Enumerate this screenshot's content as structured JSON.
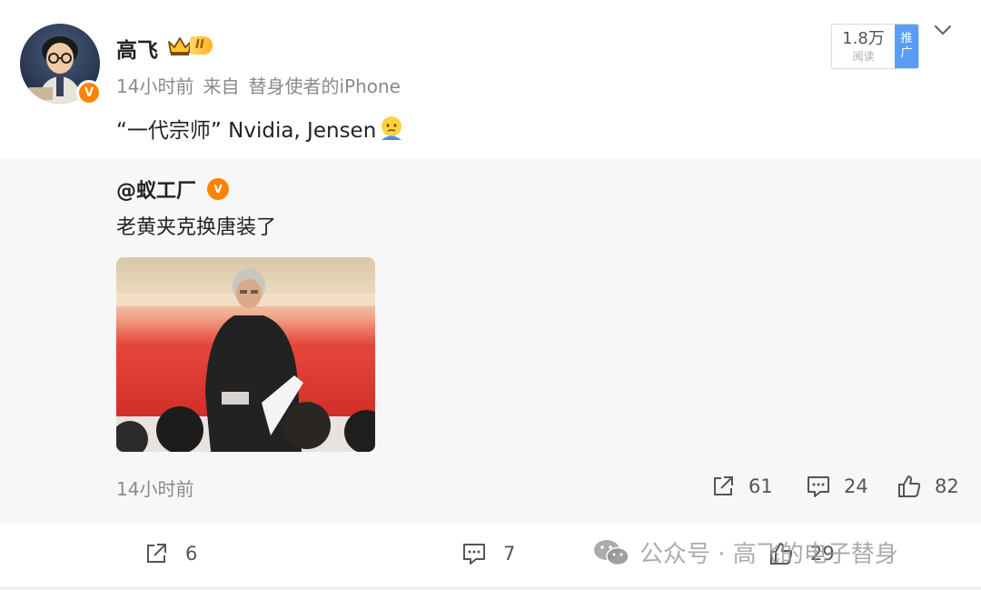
{
  "post": {
    "author": "高飞",
    "vip_level": "II",
    "time": "14小时前",
    "source_prefix": "来自",
    "source": "替身使者的iPhone",
    "text": "“一代宗师” Nvidia, Jensen",
    "emoji": "cold-sweat-face-emoji"
  },
  "stats_box": {
    "reads": "1.8万",
    "reads_label": "阅读",
    "promote_top": "推",
    "promote_bottom": "广"
  },
  "repost": {
    "author": "@蚁工厂",
    "verified_mark": "V",
    "text": "老黄夹克换唐装了",
    "time": "14小时前",
    "shares": "61",
    "comments": "24",
    "likes": "82"
  },
  "actions": {
    "shares": "6",
    "comments": "7",
    "likes": "29"
  },
  "watermark": {
    "text": "公众号 · 高飞的电子替身"
  },
  "colors": {
    "verified": "#ff8200",
    "promote": "#5b9cf6",
    "repost_bg": "#f7f7f7",
    "meta_text": "#8a8a8a"
  },
  "icons": [
    "chevron-down-icon",
    "share-icon",
    "comment-icon",
    "like-icon",
    "wechat-icon",
    "crown-icon"
  ]
}
